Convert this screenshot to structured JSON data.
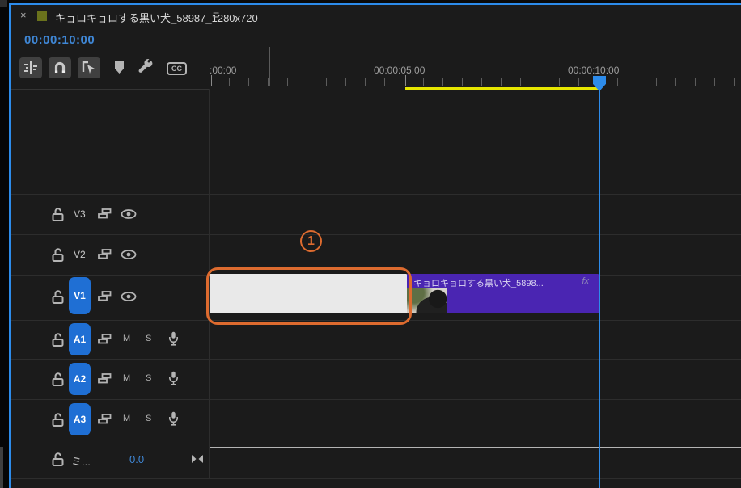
{
  "tab": {
    "close_label": "×",
    "title": "キョロキョロする黒い犬_58987_1280x720",
    "menu_label": "≡"
  },
  "timecode": "00:00:10:00",
  "toolbar": {
    "cc_label": "CC"
  },
  "ruler": {
    "labels": [
      ":00:00",
      "00:00:05:00",
      "00:00:10:00"
    ]
  },
  "tracks": {
    "video": [
      {
        "name": "V3"
      },
      {
        "name": "V2"
      },
      {
        "name": "V1"
      }
    ],
    "audio": [
      {
        "name": "A1",
        "mute": "M",
        "solo": "S"
      },
      {
        "name": "A2",
        "mute": "M",
        "solo": "S"
      },
      {
        "name": "A3",
        "mute": "M",
        "solo": "S"
      }
    ],
    "master": {
      "name": "ミ...",
      "gain": "0.0"
    }
  },
  "clips": {
    "video_clip": {
      "label": "キョロキョロする黒い犬_5898...",
      "fx_badge": "fx"
    }
  },
  "annotation": {
    "number": "1"
  },
  "colors": {
    "accent_blue": "#2d8ceb",
    "timecode_blue": "#3f87d6",
    "work_area_yellow": "#e6e600",
    "clip_purple": "#4a25b2",
    "annotation_orange": "#dd6b2f"
  }
}
